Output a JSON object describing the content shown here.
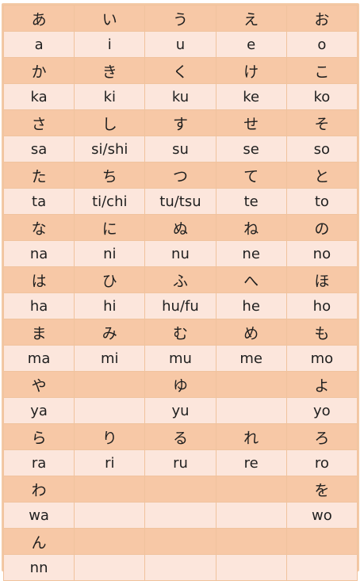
{
  "rows": [
    {
      "kind": "kana",
      "cells": [
        "あ",
        "い",
        "う",
        "え",
        "お"
      ]
    },
    {
      "kind": "romaji",
      "cells": [
        "a",
        "i",
        "u",
        "e",
        "o"
      ]
    },
    {
      "kind": "kana",
      "cells": [
        "か",
        "き",
        "く",
        "け",
        "こ"
      ]
    },
    {
      "kind": "romaji",
      "cells": [
        "ka",
        "ki",
        "ku",
        "ke",
        "ko"
      ]
    },
    {
      "kind": "kana",
      "cells": [
        "さ",
        "し",
        "す",
        "せ",
        "そ"
      ]
    },
    {
      "kind": "romaji",
      "cells": [
        "sa",
        "si/shi",
        "su",
        "se",
        "so"
      ]
    },
    {
      "kind": "kana",
      "cells": [
        "た",
        "ち",
        "つ",
        "て",
        "と"
      ]
    },
    {
      "kind": "romaji",
      "cells": [
        "ta",
        "ti/chi",
        "tu/tsu",
        "te",
        "to"
      ]
    },
    {
      "kind": "kana",
      "cells": [
        "な",
        "に",
        "ぬ",
        "ね",
        "の"
      ]
    },
    {
      "kind": "romaji",
      "cells": [
        "na",
        "ni",
        "nu",
        "ne",
        "no"
      ]
    },
    {
      "kind": "kana",
      "cells": [
        "は",
        "ひ",
        "ふ",
        "へ",
        "ほ"
      ]
    },
    {
      "kind": "romaji",
      "cells": [
        "ha",
        "hi",
        "hu/fu",
        "he",
        "ho"
      ]
    },
    {
      "kind": "kana",
      "cells": [
        "ま",
        "み",
        "む",
        "め",
        "も"
      ]
    },
    {
      "kind": "romaji",
      "cells": [
        "ma",
        "mi",
        "mu",
        "me",
        "mo"
      ]
    },
    {
      "kind": "kana",
      "cells": [
        "や",
        "",
        "ゆ",
        "",
        "よ"
      ]
    },
    {
      "kind": "romaji",
      "cells": [
        "ya",
        "",
        "yu",
        "",
        "yo"
      ]
    },
    {
      "kind": "kana",
      "cells": [
        "ら",
        "り",
        "る",
        "れ",
        "ろ"
      ]
    },
    {
      "kind": "romaji",
      "cells": [
        "ra",
        "ri",
        "ru",
        "re",
        "ro"
      ]
    },
    {
      "kind": "kana",
      "cells": [
        "わ",
        "",
        "",
        "",
        "を"
      ]
    },
    {
      "kind": "romaji",
      "cells": [
        "wa",
        "",
        "",
        "",
        "wo"
      ]
    },
    {
      "kind": "kana",
      "cells": [
        "ん",
        "",
        "",
        "",
        ""
      ]
    },
    {
      "kind": "romaji",
      "cells": [
        "nn",
        "",
        "",
        "",
        ""
      ]
    }
  ],
  "colors": {
    "kana_row_bg": "#f7c8a6",
    "romaji_row_bg": "#fce6dc",
    "grid_line": "#f0c39e",
    "text": "#1f1f1f"
  }
}
